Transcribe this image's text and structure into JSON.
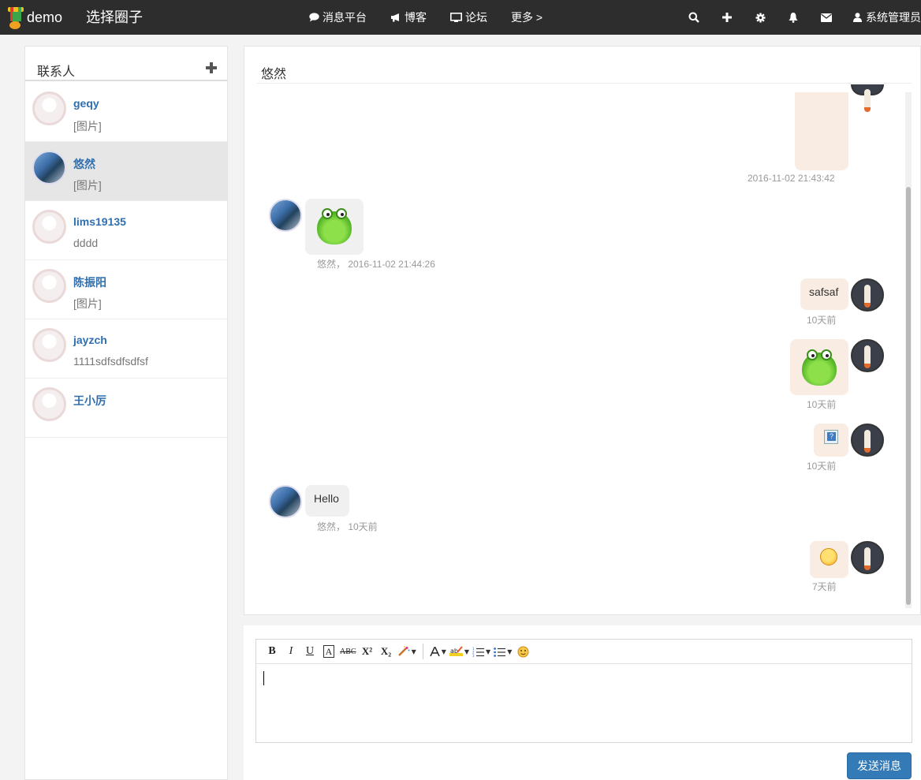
{
  "navbar": {
    "brand": "demo",
    "circle_title": "选择圈子",
    "items": [
      {
        "icon": "comment-icon",
        "label": "消息平台"
      },
      {
        "icon": "bullhorn-icon",
        "label": "博客"
      },
      {
        "icon": "desktop-icon",
        "label": "论坛"
      },
      {
        "icon": "",
        "label": "更多 >"
      }
    ],
    "right_icons": [
      "search-icon",
      "plus-icon",
      "gear-icon",
      "bell-icon",
      "envelope-icon"
    ],
    "user": "系统管理员"
  },
  "contacts": {
    "title": "联系人",
    "items": [
      {
        "name": "geqy",
        "last": "[图片]",
        "avatar": "default"
      },
      {
        "name": "悠然",
        "last": "[图片]",
        "avatar": "sky",
        "active": true
      },
      {
        "name": "lims19135",
        "last": "dddd",
        "avatar": "default"
      },
      {
        "name": "陈振阳",
        "last": "[图片]",
        "avatar": "default"
      },
      {
        "name": "jayzch",
        "last": "1111sdfsdfsdfsf",
        "avatar": "default"
      },
      {
        "name": "王小厉",
        "last": "",
        "avatar": "default"
      }
    ]
  },
  "chat": {
    "title": "悠然",
    "messages": [
      {
        "side": "out",
        "type": "image",
        "meta": "2016-11-02 21:43:42"
      },
      {
        "side": "in",
        "type": "sticker-frog",
        "meta": "悠然，  2016-11-02 21:44:26"
      },
      {
        "side": "out",
        "type": "text",
        "text": "safsaf",
        "meta": "10天前"
      },
      {
        "side": "out",
        "type": "sticker-frog",
        "meta": "10天前"
      },
      {
        "side": "out",
        "type": "broken-image",
        "meta": "10天前"
      },
      {
        "side": "in",
        "type": "text",
        "text": "Hello",
        "meta": "悠然，  10天前"
      },
      {
        "side": "out",
        "type": "emoji",
        "meta": "7天前"
      }
    ]
  },
  "toolbar": {
    "buttons": [
      {
        "name": "bold-button",
        "label": "B"
      },
      {
        "name": "italic-button",
        "label": "I"
      },
      {
        "name": "underline-button",
        "label": "U"
      },
      {
        "name": "font-box-button",
        "label": "A"
      },
      {
        "name": "strikethrough-button",
        "label": "ABC"
      },
      {
        "name": "superscript-button",
        "label": "X²"
      },
      {
        "name": "subscript-button",
        "label": "X₂"
      }
    ]
  },
  "send_label": "发送消息",
  "colors": {
    "navbar": "#2d2d2d",
    "link": "#2f6fb0",
    "active_row": "#e6e6e6",
    "bubble_in": "#f0f0f0",
    "bubble_out": "#f9ece2",
    "send_button": "#337ab7"
  }
}
